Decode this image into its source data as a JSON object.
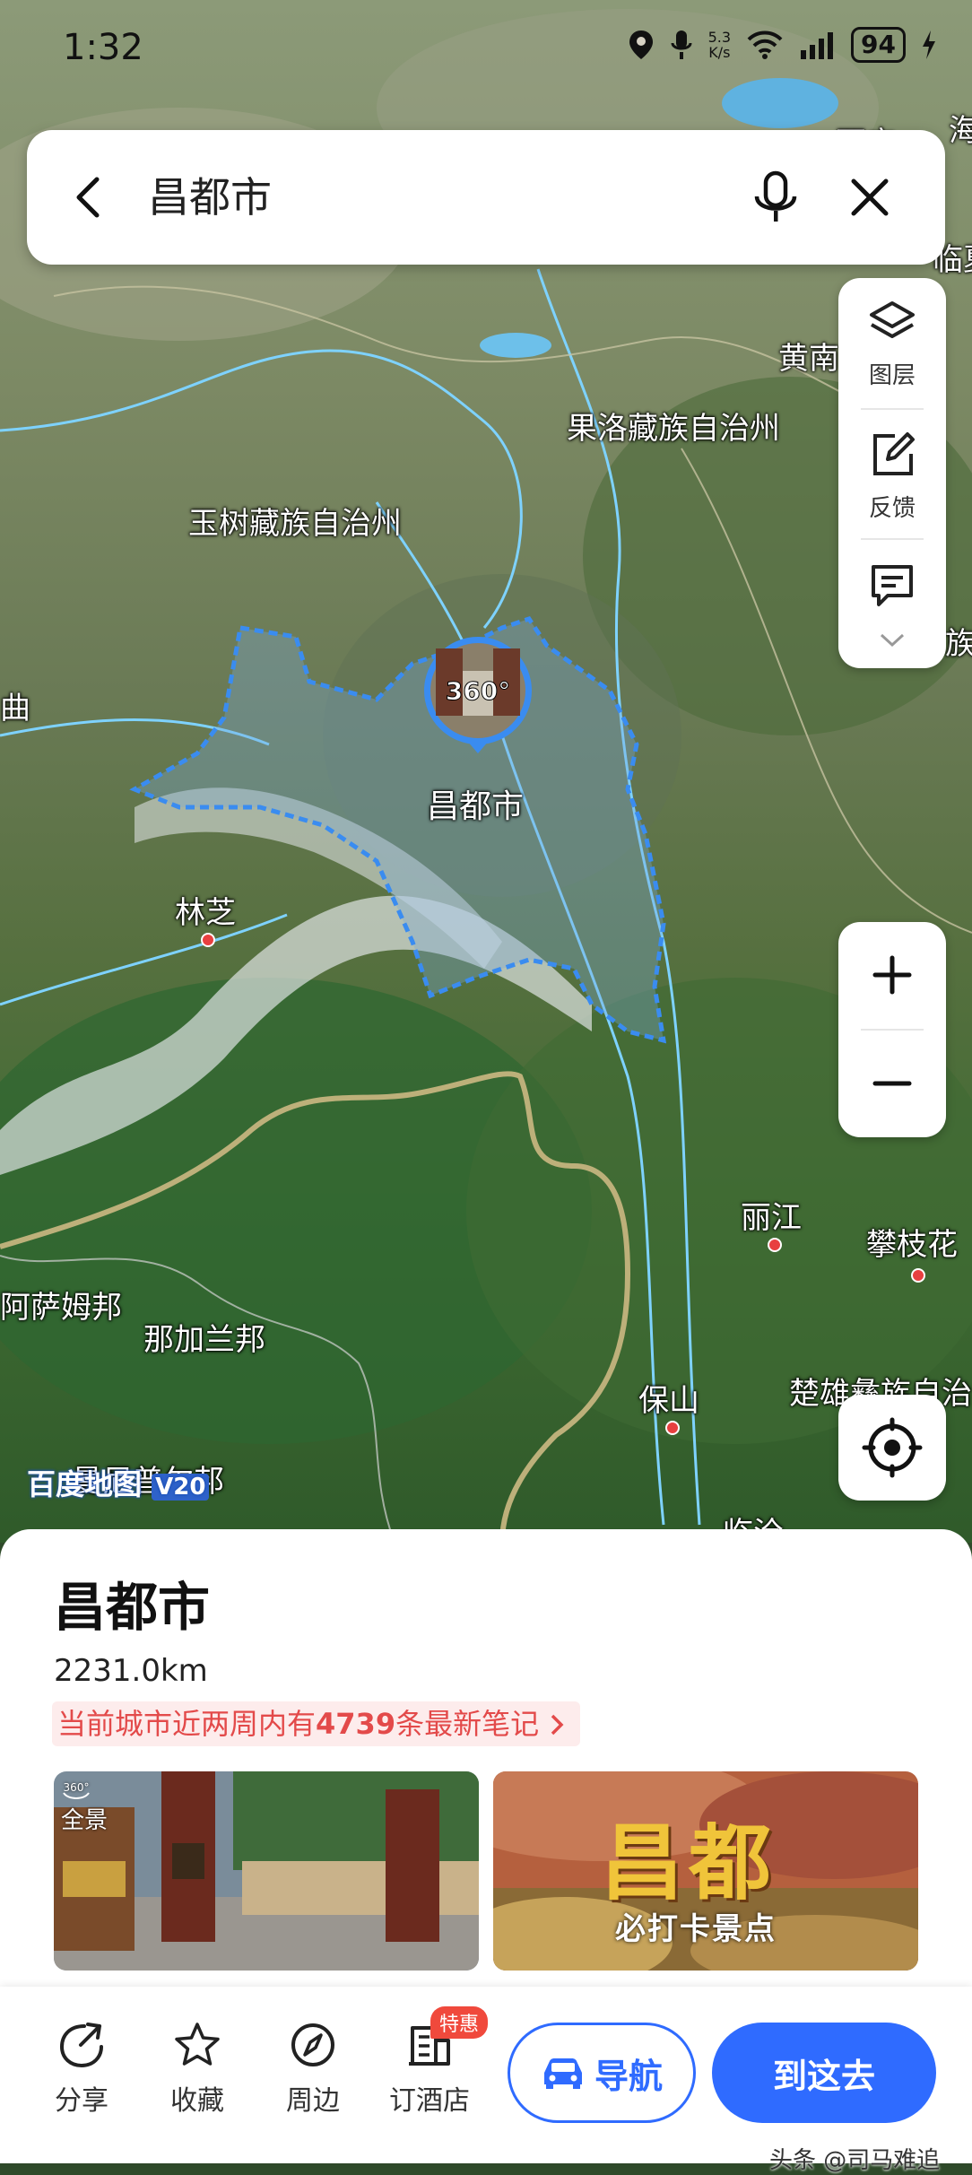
{
  "status_bar": {
    "time": "1:32",
    "net_speed_value": "5.3",
    "net_speed_unit": "K/s",
    "battery": "94"
  },
  "search": {
    "query": "昌都市"
  },
  "side_panel": {
    "layers_label": "图层",
    "feedback_label": "反馈"
  },
  "map": {
    "pin_badge_text": "360°",
    "labels": {
      "changdu": "昌都市",
      "yushu": "玉树藏族自治州",
      "guoluo": "果洛藏族自治州",
      "huangnan": "黄南",
      "xining": "西宁",
      "haixi": "海",
      "linxia": "临夏",
      "zu": "族",
      "qu": "曲",
      "linzhi": "林芝",
      "lijiang": "丽江",
      "panzhihua": "攀枝花",
      "baoshan": "保山",
      "chuxiong": "楚雄彝族自治",
      "assam": "阿萨姆邦",
      "nagaland": "那加兰邦",
      "manipur": "曼尼普尔邦",
      "lincang": "临沧"
    },
    "watermark": "百度地图",
    "watermark_version": "V20"
  },
  "place": {
    "title": "昌都市",
    "distance": "2231.0km",
    "notes_prefix": "当前城市近两周内有",
    "notes_count": "4739",
    "notes_suffix": "条最新笔记",
    "photo1_tag": "全景",
    "photo2_big": "昌都",
    "photo2_small": "必打卡景点"
  },
  "actions": {
    "share": "分享",
    "favorite": "收藏",
    "nearby": "周边",
    "hotel": "订酒店",
    "hotel_badge": "特惠",
    "navigate": "导航",
    "go_here": "到这去"
  },
  "source_watermark": "头条 @司马难追",
  "colors": {
    "primary_blue": "#2f6bff",
    "notes_red": "#e34a4a",
    "boundary_blue": "#3a8cf0"
  }
}
